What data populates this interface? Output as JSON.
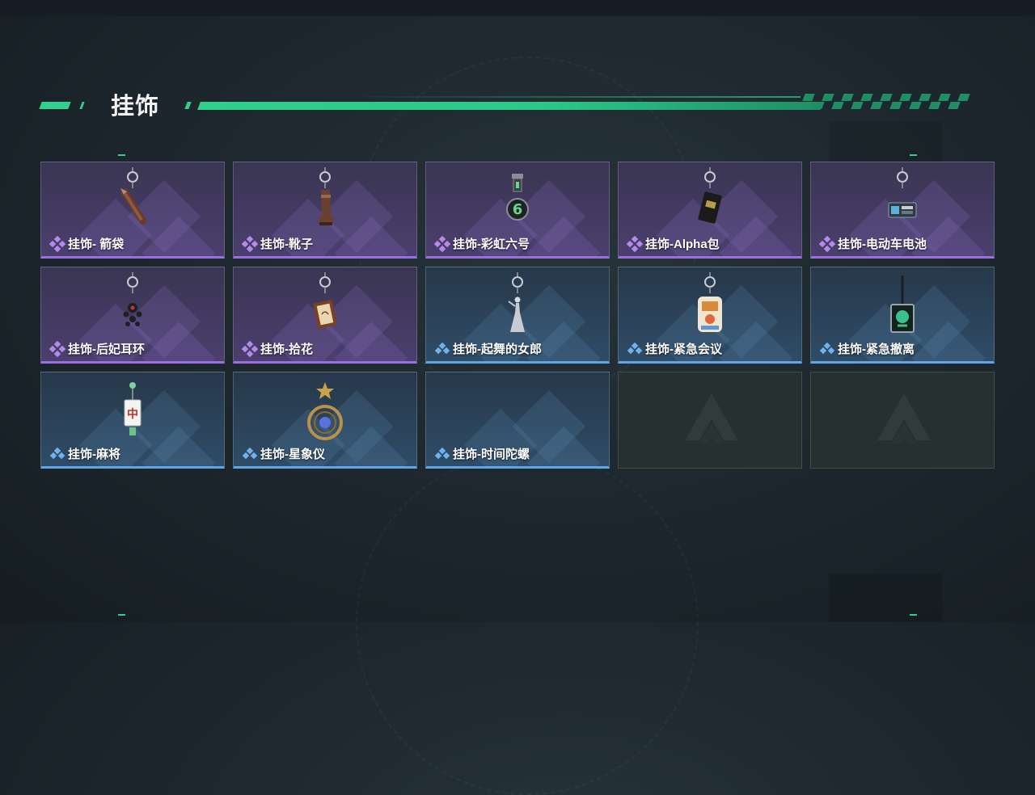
{
  "section": {
    "title": "挂饰"
  },
  "colors": {
    "accent": "#2fd08a",
    "purple_rarity": "#9a6fe0",
    "blue_rarity": "#5fa6e6"
  },
  "items": [
    {
      "label": "挂饰- 箭袋",
      "rarity": "purple",
      "icon": "quiver-charm-icon"
    },
    {
      "label": "挂饰-靴子",
      "rarity": "purple",
      "icon": "boot-charm-icon"
    },
    {
      "label": "挂饰-彩虹六号",
      "rarity": "purple",
      "icon": "rainbow-six-charm-icon"
    },
    {
      "label": "挂饰-Alpha包",
      "rarity": "purple",
      "icon": "alpha-pack-charm-icon"
    },
    {
      "label": "挂饰-电动车电池",
      "rarity": "purple",
      "icon": "ev-battery-charm-icon"
    },
    {
      "label": "挂饰-后妃耳环",
      "rarity": "purple",
      "icon": "earring-charm-icon"
    },
    {
      "label": "挂饰-拾花",
      "rarity": "purple",
      "icon": "flower-frame-charm-icon"
    },
    {
      "label": "挂饰-起舞的女郎",
      "rarity": "blue",
      "icon": "dancing-lady-charm-icon"
    },
    {
      "label": "挂饰-紧急会议",
      "rarity": "blue",
      "icon": "emergency-meeting-charm-icon"
    },
    {
      "label": "挂饰-紧急撤离",
      "rarity": "blue",
      "icon": "emergency-evac-charm-icon"
    },
    {
      "label": "挂饰-麻将",
      "rarity": "blue",
      "icon": "mahjong-charm-icon"
    },
    {
      "label": "挂饰-星象仪",
      "rarity": "blue",
      "icon": "astrolabe-charm-icon"
    },
    {
      "label": "挂饰-时间陀螺",
      "rarity": "blue",
      "icon": "time-top-charm-icon"
    },
    {
      "label": "",
      "rarity": "empty",
      "icon": "empty-slot-logo-icon"
    },
    {
      "label": "",
      "rarity": "empty",
      "icon": "empty-slot-logo-icon"
    }
  ]
}
